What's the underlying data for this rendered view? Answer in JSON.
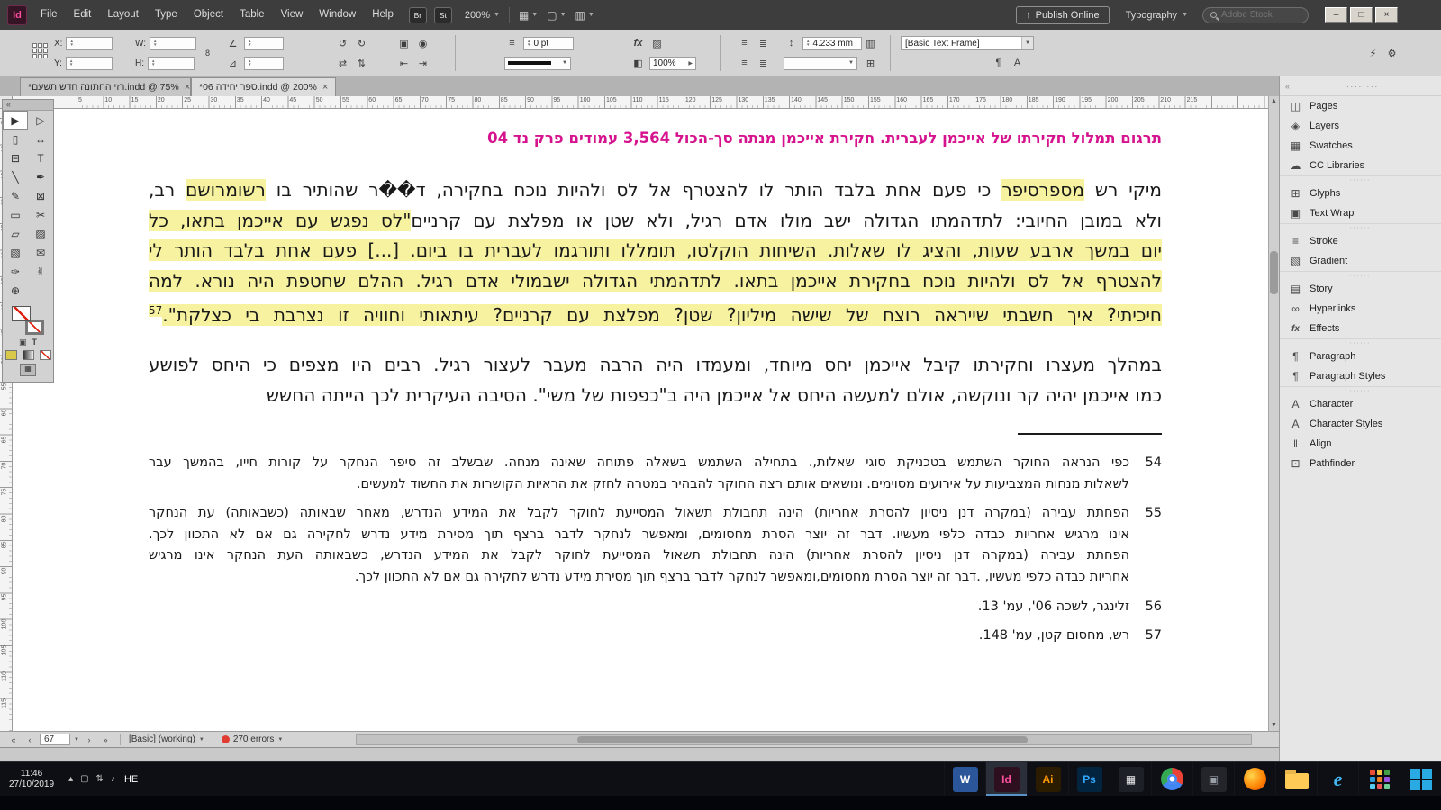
{
  "titlebar": {
    "app_badge": "Id",
    "menus": [
      "File",
      "Edit",
      "Layout",
      "Type",
      "Object",
      "Table",
      "View",
      "Window",
      "Help"
    ],
    "bridge_badge": "Br",
    "stock_badge": "St",
    "zoom_level": "200%",
    "publish_button": "Publish Online",
    "workspace": "Typography",
    "search_placeholder": "Adobe Stock"
  },
  "control_panel": {
    "x_label": "X:",
    "y_label": "Y:",
    "w_label": "W:",
    "h_label": "H:",
    "stroke_weight": "0 pt",
    "leading": "4.233 mm",
    "scale": "100%",
    "object_style": "[Basic Text Frame]"
  },
  "tabs": [
    {
      "title": "*רזי החתונה חדש תשעם.indd @ 75%",
      "active": false
    },
    {
      "title": "*ספר יחידה 06.indd @ 200%",
      "active": true
    }
  ],
  "rulers": {
    "step": 5,
    "h_max": 215,
    "v_max": 115
  },
  "tools": [
    {
      "name": "selection-tool",
      "glyph": "▶",
      "selected": true
    },
    {
      "name": "direct-selection-tool",
      "glyph": "▷"
    },
    {
      "name": "page-tool",
      "glyph": "▯"
    },
    {
      "name": "gap-tool",
      "glyph": "↔"
    },
    {
      "name": "content-collector-tool",
      "glyph": "⊟"
    },
    {
      "name": "type-tool",
      "glyph": "T"
    },
    {
      "name": "line-tool",
      "glyph": "╲"
    },
    {
      "name": "pen-tool",
      "glyph": "✒"
    },
    {
      "name": "pencil-tool",
      "glyph": "✎"
    },
    {
      "name": "rectangle-frame-tool",
      "glyph": "⊠"
    },
    {
      "name": "rectangle-tool",
      "glyph": "▭"
    },
    {
      "name": "scissors-tool",
      "glyph": "✂"
    },
    {
      "name": "free-transform-tool",
      "glyph": "▱"
    },
    {
      "name": "gradient-swatch-tool",
      "glyph": "▨"
    },
    {
      "name": "gradient-feather-tool",
      "glyph": "▧"
    },
    {
      "name": "note-tool",
      "glyph": "✉"
    },
    {
      "name": "eyedropper-tool",
      "glyph": "✑"
    },
    {
      "name": "hand-tool",
      "glyph": "✌"
    },
    {
      "name": "zoom-tool",
      "glyph": "⊕"
    }
  ],
  "document": {
    "headline": "תרגום תמלול חקירתו של אייכמן לעברית. חקירת אייכמן מנתה סך-הכול 3,564 עמודים פרק נד 04",
    "headline_color": "#d6138f",
    "highlight_color": "#f7f2a0",
    "para1_lines": [
      {
        "justify": true,
        "segs": [
          {
            "t": "מיקי רש ",
            "h": false
          },
          {
            "t": "מספרסיפר",
            "h": true
          },
          {
            "t": " כי פעם אחת בלבד הותר לו להצטרף אל לס ולהיות נוכח בחקירה, ד��ר שהותיר בו ",
            "h": false
          },
          {
            "t": "רשומרושם",
            "h": true
          },
          {
            "t": " רב,",
            "h": false
          }
        ]
      },
      {
        "justify": true,
        "segs": [
          {
            "t": "ולא במובן החיובי: לתדהמתו הגדולה ישב מולו אדם רגיל, ולא שטן או מפלצת עם קרניים",
            "h": false
          },
          {
            "t": "\"לס נפגש עם אייכמן בתאו, כל",
            "h": true
          }
        ]
      },
      {
        "justify": true,
        "segs": [
          {
            "t": "יום במשך ארבע שעות, והציג לו שאלות. השיחות הוקלטו, תומללו ותורגמו לעברית בו ביום. [...] פעם אחת בלבד הותר לי",
            "h": true
          }
        ]
      },
      {
        "justify": true,
        "segs": [
          {
            "t": "להצטרף אל לס ולהיות נוכח בחקירת אייכמן בתאו. לתדהמתי הגדולה ישבמולי אדם רגיל. ההלם שחטפת היה נורא. למה",
            "h": true
          }
        ]
      },
      {
        "justify": true,
        "segs": [
          {
            "t": "חיכיתי? איך חשבתי שייראה רוצח של שישה מיליון? שטן? מפלצת עם קרניים? עיתאותי וחוויה זו נצרבת בי כצלקת\".",
            "h": true
          },
          {
            "t": "57",
            "h": true,
            "sup": true
          }
        ]
      }
    ],
    "para2_lines": [
      {
        "justify": true,
        "text": "במהלך מעצרו וחקירתו קיבל אייכמן יחס מיוחד, ומעמדו היה הרבה מעבר לעצור רגיל. רבים היו מצפים כי היחס לפושע"
      },
      {
        "justify": false,
        "text": "כמו אייכמן יהיה קר ונוקשה, אולם למעשה היחס אל אייכמן היה ב\"כפפות של משי\". הסיבה העיקרית לכך הייתה החשש"
      }
    ],
    "footnotes": [
      {
        "num": "54",
        "lines": [
          "כפי הנראה החוקר השתמש בטכניקת סוגי שאלות,. בתחילה השתמש בשאלה פתוחה שאינה מנחה. שבשלב זה סיפר הנחקר על קורות חייו, בהמשך עבר",
          "לשאלות מנחות המצביעות על אירועים מסוימים. ונושאים אותם רצה החוקר להבהיר במטרה לחזק את הראיות הקושרות את החשוד למעשים."
        ]
      },
      {
        "num": "55",
        "lines": [
          "הפחתת עבירה (במקרה דנן ניסיון להסרת אחריות) הינה תחבולת תשאול המסייעת לחוקר לקבל את המידע הנדרש, מאחר שבאותה (כשבאותה) עת הנחקר",
          "אינו מרגיש אחריות כבדה כלפי מעשיו. דבר זה יוצר הסרת מחסומים, ומאפשר לנחקר לדבר ברצף תוך מסירת מידע נדרש לחקירה גם אם לא התכוון לכך.",
          "הפחתת עבירה (במקרה דנן ניסיון להסרת אחריות) הינה תחבולת תשאול המסייעת לחוקר לקבל את המידע הנדרש, כשבאותה העת הנחקר אינו מרגיש",
          "אחריות כבדה כלפי מעשיו, .דבר זה יוצר הסרת מחסומים,ומאפשר לנחקר לדבר ברצף תוך מסירת מידע נדרש לחקירה גם אם לא התכוון לכך."
        ]
      },
      {
        "num": "56",
        "lines": [
          "זלינגר, לשכה 06', עמ' 13."
        ]
      },
      {
        "num": "57",
        "lines": [
          "רש, מחסום קטן, עמ' 148."
        ]
      }
    ]
  },
  "status_bar": {
    "page": "67",
    "preset": "[Basic] (working)",
    "errors": "270 errors"
  },
  "right_panel": {
    "groups": [
      [
        {
          "id": "pages",
          "label": "Pages",
          "glyph": "◫"
        },
        {
          "id": "layers",
          "label": "Layers",
          "glyph": "◈"
        },
        {
          "id": "swatches",
          "label": "Swatches",
          "glyph": "▦"
        },
        {
          "id": "cc-libraries",
          "label": "CC Libraries",
          "glyph": "☁"
        }
      ],
      [
        {
          "id": "glyphs",
          "label": "Glyphs",
          "glyph": "⊞"
        },
        {
          "id": "text-wrap",
          "label": "Text Wrap",
          "glyph": "▣"
        }
      ],
      [
        {
          "id": "stroke",
          "label": "Stroke",
          "glyph": "≡"
        },
        {
          "id": "gradient",
          "label": "Gradient",
          "glyph": "▧"
        }
      ],
      [
        {
          "id": "story",
          "label": "Story",
          "glyph": "▤"
        },
        {
          "id": "hyperlinks",
          "label": "Hyperlinks",
          "glyph": "∞"
        },
        {
          "id": "effects",
          "label": "Effects",
          "glyph": "fx"
        }
      ],
      [
        {
          "id": "paragraph",
          "label": "Paragraph",
          "glyph": "¶"
        },
        {
          "id": "paragraph-styles",
          "label": "Paragraph Styles",
          "glyph": "¶"
        }
      ],
      [
        {
          "id": "character",
          "label": "Character",
          "glyph": "A"
        },
        {
          "id": "character-styles",
          "label": "Character Styles",
          "glyph": "A"
        },
        {
          "id": "align",
          "label": "Align",
          "glyph": "‖"
        },
        {
          "id": "pathfinder",
          "label": "Pathfinder",
          "glyph": "⊡"
        }
      ]
    ]
  },
  "taskbar": {
    "time": "11:46",
    "date": "27/10/2019",
    "lang": "HE",
    "tray": [
      {
        "name": "tray-show-hidden-icon",
        "glyph": "▴"
      },
      {
        "name": "tray-display-icon",
        "glyph": "▢"
      },
      {
        "name": "tray-network-icon",
        "glyph": "⇅"
      },
      {
        "name": "tray-volume-icon",
        "glyph": "♪"
      }
    ],
    "apps": [
      {
        "name": "taskbar-word",
        "glyph": "W",
        "bg": "#2b579a",
        "fg": "#ffffff"
      },
      {
        "name": "taskbar-indesign",
        "glyph": "Id",
        "bg": "#2e0f1f",
        "fg": "#ff4e9b",
        "active": true
      },
      {
        "name": "taskbar-illustrator",
        "glyph": "Ai",
        "bg": "#2b1c00",
        "fg": "#ff9a00"
      },
      {
        "name": "taskbar-photoshop",
        "glyph": "Ps",
        "bg": "#03243f",
        "fg": "#31a8ff"
      },
      {
        "name": "taskbar-metro-apps",
        "glyph": "▦",
        "bg": "#1d2026",
        "fg": "#e8e8e8"
      },
      {
        "name": "taskbar-chrome",
        "type": "chrome"
      },
      {
        "name": "taskbar-app-dark",
        "glyph": "▣",
        "bg": "#23252b",
        "fg": "#9aa0a8"
      },
      {
        "name": "taskbar-firefox",
        "type": "circle-orange"
      },
      {
        "name": "taskbar-file-explorer",
        "type": "folder"
      },
      {
        "name": "taskbar-internet-explorer",
        "glyph": "e",
        "bg": "transparent",
        "fg": "#45b6f2",
        "ie": true
      },
      {
        "name": "taskbar-apps-grid",
        "type": "grid-colored"
      },
      {
        "name": "taskbar-start",
        "type": "windows"
      }
    ]
  }
}
